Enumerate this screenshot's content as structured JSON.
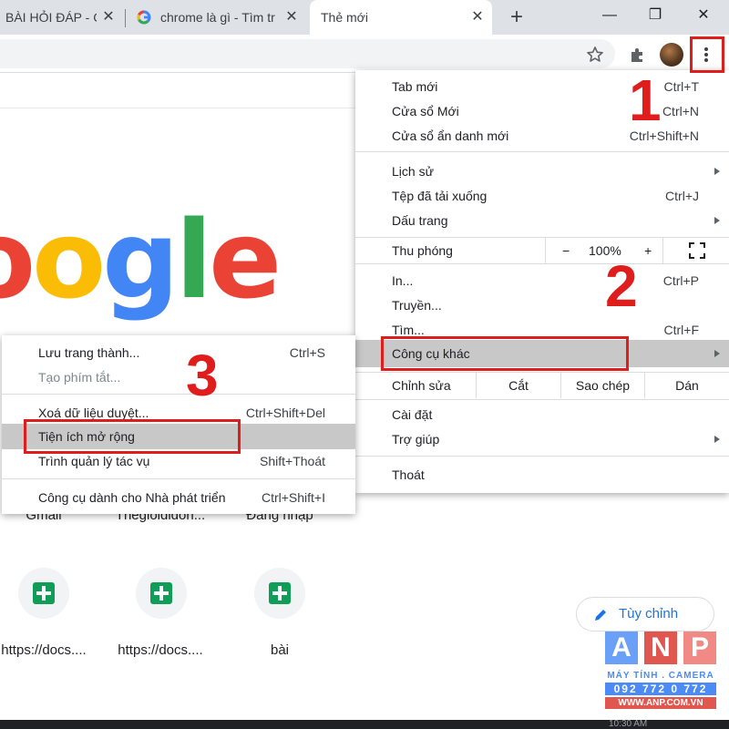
{
  "tabs": [
    {
      "title": "BÀI HỎI ĐÁP - C",
      "close": "✕"
    },
    {
      "title": "chrome là gì - Tìm tr",
      "close": "✕"
    },
    {
      "title": "Thẻ mới",
      "close": "✕"
    }
  ],
  "new_tab_glyph": "+",
  "window_controls": {
    "minimize": "—",
    "restore": "❐",
    "close": "✕"
  },
  "page": {
    "logo_text": "oogle",
    "logo_colors": [
      "#ea4335",
      "#fbbc05",
      "#4285f4",
      "#34a853",
      "#ea4335"
    ],
    "shortcuts_row1": [
      "Gmail",
      "Thegioididon...",
      "Đăng nhập"
    ],
    "shortcuts_row2": [
      "https://docs....",
      "https://docs....",
      "bài"
    ],
    "customize": "Tùy chỉnh",
    "bottom_text": "10:30 AM"
  },
  "main_menu": {
    "items": [
      {
        "label": "Tab mới",
        "shortcut": "Ctrl+T"
      },
      {
        "label": "Cửa sổ Mới",
        "shortcut": "Ctrl+N"
      },
      {
        "label": "Cửa sổ ẩn danh mới",
        "shortcut": "Ctrl+Shift+N"
      },
      {
        "label": "Lịch sử",
        "shortcut": ""
      },
      {
        "label": "Tệp đã tải xuống",
        "shortcut": "Ctrl+J"
      },
      {
        "label": "Dấu trang",
        "shortcut": ""
      },
      {
        "label": "In...",
        "shortcut": "Ctrl+P"
      },
      {
        "label": "Truyền...",
        "shortcut": ""
      },
      {
        "label": "Tìm...",
        "shortcut": "Ctrl+F"
      },
      {
        "label": "Công cụ khác",
        "shortcut": ""
      },
      {
        "label": "Cài đặt",
        "shortcut": ""
      },
      {
        "label": "Trợ giúp",
        "shortcut": ""
      },
      {
        "label": "Thoát",
        "shortcut": ""
      }
    ],
    "zoom": {
      "label": "Thu phóng",
      "minus": "−",
      "value": "100%",
      "plus": "+"
    },
    "edit": {
      "label": "Chỉnh sửa",
      "cut": "Cắt",
      "copy": "Sao chép",
      "paste": "Dán"
    }
  },
  "sub_menu": {
    "items": [
      {
        "label": "Lưu trang thành...",
        "shortcut": "Ctrl+S"
      },
      {
        "label": "Tạo phím tắt...",
        "shortcut": ""
      },
      {
        "label": "Xoá dữ liệu duyệt...",
        "shortcut": "Ctrl+Shift+Del"
      },
      {
        "label": "Tiện ích mở rộng",
        "shortcut": ""
      },
      {
        "label": "Trình quản lý tác vụ",
        "shortcut": "Shift+Thoát"
      },
      {
        "label": "Công cụ dành cho Nhà phát triển",
        "shortcut": "Ctrl+Shift+I"
      }
    ]
  },
  "annotations": {
    "step1": "1",
    "step2": "2",
    "step3": "3",
    "color": "#e01d1d"
  },
  "watermark": {
    "letters": [
      "A",
      "N",
      "P"
    ],
    "letter_colors": [
      "#6aa0f7",
      "#e0574f",
      "#f18a84"
    ],
    "line1": "MÁY TÍNH . CAMERA",
    "line2": "092 772 0 772",
    "line3": "WWW.ANP.COM.VN"
  }
}
